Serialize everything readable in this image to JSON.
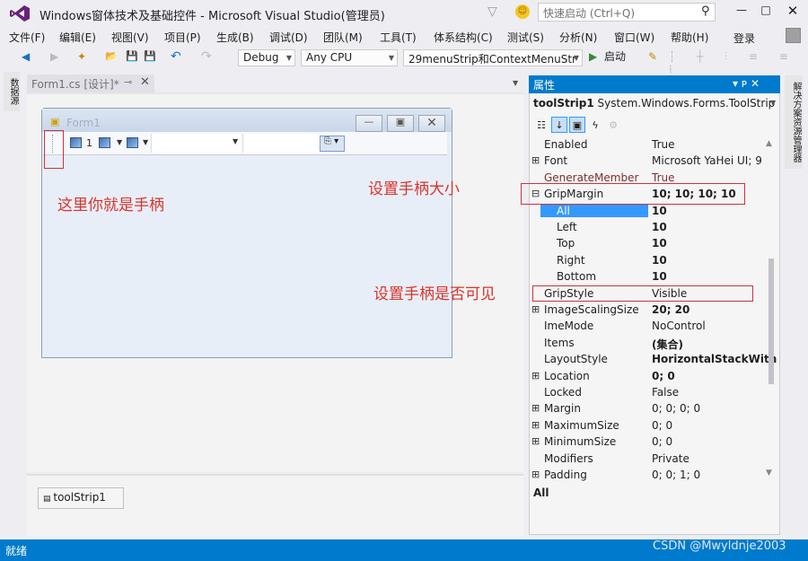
{
  "window": {
    "title": "Windows窗体技术及基础控件 - Microsoft Visual Studio(管理员)",
    "quick_launch_placeholder": "快速启动 (Ctrl+Q)",
    "icons": {
      "logo": "visual-studio-logo",
      "filter": "▽",
      "feedback": "☺",
      "search": "⚲",
      "minimize": "—",
      "maximize": "□",
      "close": "✕"
    }
  },
  "menu": {
    "items": [
      "文件(F)",
      "编辑(E)",
      "视图(V)",
      "项目(P)",
      "生成(B)",
      "调试(D)",
      "团队(M)",
      "工具(T)",
      "体系结构(C)",
      "测试(S)",
      "分析(N)",
      "窗口(W)",
      "帮助(H)"
    ],
    "login": "登录"
  },
  "toolbar": {
    "config": "Debug",
    "platform": "Any CPU",
    "startup_project": "29menuStrip和ContextMenuStr",
    "start_label": "启动",
    "icons": {
      "back": "◀",
      "forward": "▶",
      "new_project": "✦",
      "open": "📂",
      "save": "💾",
      "save_all": "💾",
      "undo": "↶",
      "redo": "↷",
      "play": "▶",
      "attach": "✎"
    }
  },
  "left_sidebar": {
    "tab_label": "数据源"
  },
  "document": {
    "tab_label": "Form1.cs [设计]*",
    "pin_icon": "⊸",
    "close_icon": "✕"
  },
  "designer": {
    "form_title": "Form1",
    "toolstrip": {
      "label_text": "1"
    },
    "annotations": {
      "grip_note": "这里你就是手柄",
      "grip_margin_note": "设置手柄大小",
      "grip_style_note": "设置手柄是否可见"
    }
  },
  "component_tray": {
    "item_label": "toolStrip1"
  },
  "properties": {
    "title": "属性",
    "header_controls": "▾ ᴘ ✕",
    "object_name": "toolStrip1",
    "object_type": "System.Windows.Forms.ToolStrip",
    "rows": [
      {
        "name": "Enabled",
        "value": "True",
        "exp": "",
        "bold": false
      },
      {
        "name": "Font",
        "value": "Microsoft YaHei UI; 9",
        "exp": "⊞",
        "bold": false
      },
      {
        "name": "GenerateMember",
        "value": "True",
        "exp": "",
        "bold": false
      },
      {
        "name": "GripMargin",
        "value": "10; 10; 10; 10",
        "exp": "⊟",
        "bold": true
      },
      {
        "name": "All",
        "value": "10",
        "exp": "",
        "bold": true,
        "sub": true,
        "selected": true
      },
      {
        "name": "Left",
        "value": "10",
        "exp": "",
        "bold": true,
        "sub": true
      },
      {
        "name": "Top",
        "value": "10",
        "exp": "",
        "bold": true,
        "sub": true
      },
      {
        "name": "Right",
        "value": "10",
        "exp": "",
        "bold": true,
        "sub": true
      },
      {
        "name": "Bottom",
        "value": "10",
        "exp": "",
        "bold": true,
        "sub": true
      },
      {
        "name": "GripStyle",
        "value": "Visible",
        "exp": "",
        "bold": false
      },
      {
        "name": "ImageScalingSize",
        "value": "20; 20",
        "exp": "⊞",
        "bold": true
      },
      {
        "name": "ImeMode",
        "value": "NoControl",
        "exp": "",
        "bold": false
      },
      {
        "name": "Items",
        "value": "(集合)",
        "exp": "",
        "bold": true
      },
      {
        "name": "LayoutStyle",
        "value": "HorizontalStackWith",
        "exp": "",
        "bold": true
      },
      {
        "name": "Location",
        "value": "0; 0",
        "exp": "⊞",
        "bold": true
      },
      {
        "name": "Locked",
        "value": "False",
        "exp": "",
        "bold": false
      },
      {
        "name": "Margin",
        "value": "0; 0; 0; 0",
        "exp": "⊞",
        "bold": false
      },
      {
        "name": "MaximumSize",
        "value": "0; 0",
        "exp": "⊞",
        "bold": false
      },
      {
        "name": "MinimumSize",
        "value": "0; 0",
        "exp": "⊞",
        "bold": false
      },
      {
        "name": "Modifiers",
        "value": "Private",
        "exp": "",
        "bold": false
      },
      {
        "name": "Padding",
        "value": "0; 0; 1; 0",
        "exp": "⊞",
        "bold": false
      }
    ],
    "description_title": "All"
  },
  "right_sidebar": {
    "tab_label": "解决方案资源管理器"
  },
  "statusbar": {
    "text": "就绪",
    "watermark": "CSDN @Mwyldnje2003"
  }
}
